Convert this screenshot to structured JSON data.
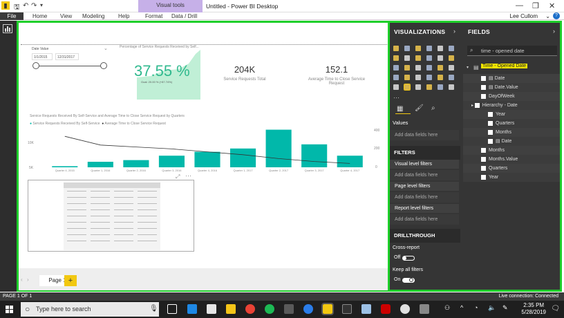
{
  "app": {
    "doc_title": "Untitled - Power BI Desktop",
    "context_group": "Visual tools",
    "user": "Lee Cullom",
    "help": "?"
  },
  "ribbon": {
    "tabs": [
      "File",
      "Home",
      "View",
      "Modeling",
      "Help",
      "Format",
      "Data / Drill"
    ]
  },
  "slicer": {
    "title": "Date Value",
    "start": "1/1/2015",
    "end": "12/31/2017"
  },
  "kpi": {
    "title": "Percentage of Service Requests Received by Self...",
    "value": "37.55 %",
    "goal": "Goal: 20.00 % (+87.74%)"
  },
  "cards": [
    {
      "value": "204K",
      "label": "Service Requests Total"
    },
    {
      "value": "152.1",
      "label": "Average Time to Close Service Request"
    }
  ],
  "combo": {
    "title": "Service Requests Received By Self-Service and Average Time to Close Service Request by Quarters",
    "legend": [
      "Service Requests Received By Self-Service",
      "Average Time to Close Service Request"
    ],
    "y_left_ticks": [
      "10K",
      "5K"
    ],
    "y_right_ticks": [
      "400",
      "200",
      "0"
    ]
  },
  "chart_data": {
    "type": "bar",
    "categories": [
      "Quarter 4, 2015",
      "Quarter 1, 2016",
      "Quarter 2, 2016",
      "Quarter 3, 2016",
      "Quarter 4, 2016",
      "Quarter 1, 2017",
      "Quarter 2, 2017",
      "Quarter 3, 2017",
      "Quarter 4, 2017"
    ],
    "series": [
      {
        "name": "Service Requests Received By Self-Service",
        "values": [
          400,
          2000,
          2600,
          4200,
          5600,
          6800,
          13600,
          8300,
          4200
        ],
        "color": "#01b8aa"
      },
      {
        "name": "Average Time to Close Service Request",
        "values": [
          320,
          230,
          210,
          190,
          160,
          130,
          90,
          60,
          40
        ],
        "color": "#333333"
      }
    ],
    "ylim": [
      0,
      14000
    ],
    "y2lim": [
      0,
      400
    ]
  },
  "pages": {
    "current": "Page 1",
    "add": "+"
  },
  "viz_pane": {
    "title": "VISUALIZATIONS",
    "values_label": "Values",
    "add_fields": "Add data fields here",
    "filters_title": "FILTERS",
    "visual_filters": "Visual level filters",
    "page_filters": "Page level filters",
    "report_filters": "Report level filters",
    "drill_title": "DRILLTHROUGH",
    "cross_report": "Cross-report",
    "off": "Off",
    "keep_filters": "Keep all filters",
    "on": "On"
  },
  "fields_pane": {
    "title": "FIELDS",
    "search_value": "time - opened date",
    "table": "Time - Opened Date",
    "items": [
      "Date",
      "Date.Value",
      "DayOfWeek",
      "Hierarchy - Date",
      "Year",
      "Quarters",
      "Months",
      "Date",
      "Months",
      "Months.Value",
      "Quarters",
      "Year"
    ]
  },
  "status": {
    "page": "PAGE 1 OF 1",
    "connection": "Live connection: Connected"
  },
  "taskbar": {
    "search": "Type here to search",
    "time": "2:35 PM",
    "date": "5/28/2019"
  },
  "colors": {
    "accent_green": "#1ecf2a",
    "teal": "#01b8aa",
    "highlight": "#f2e600"
  }
}
